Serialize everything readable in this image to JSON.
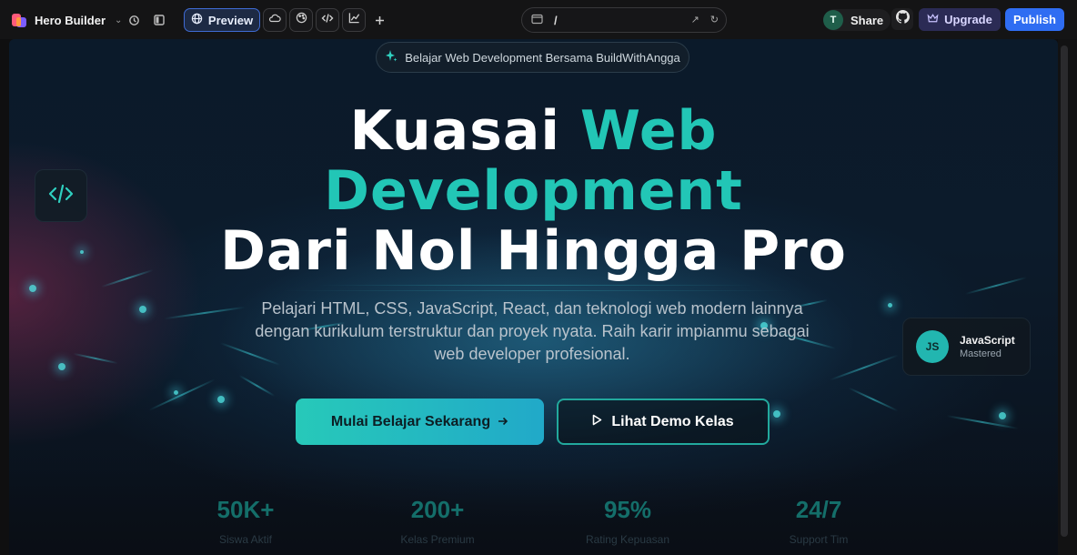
{
  "topbar": {
    "app_title": "Hero Builder",
    "preview_label": "Preview",
    "url_path": "/",
    "share_avatar": "T",
    "share_label": "Share",
    "upgrade_label": "Upgrade",
    "publish_label": "Publish",
    "icons": [
      "history-icon",
      "sidebar-toggle-icon",
      "globe-icon",
      "cloud-icon",
      "palette-icon",
      "code-icon",
      "chart-icon",
      "plus-icon",
      "external-link-icon",
      "refresh-icon",
      "github-icon",
      "crown-icon"
    ]
  },
  "hero": {
    "badge": "Belajar Web Development Bersama BuildWithAngga",
    "headline": {
      "line1_white": "Kuasai ",
      "line1_teal": "Web",
      "line2_teal": "Development",
      "line3_white": "Dari Nol Hingga Pro"
    },
    "subtitle": "Pelajari HTML, CSS, JavaScript, React, dan teknologi web modern lainnya dengan kurikulum terstruktur dan proyek nyata. Raih karir impianmu sebagai web developer profesional.",
    "cta_primary": "Mulai Belajar Sekarang",
    "cta_secondary": "Lihat Demo Kelas",
    "js_card": {
      "initials": "JS",
      "title": "JavaScript",
      "subtitle": "Mastered"
    },
    "stats": [
      {
        "value": "50K+",
        "label": "Siswa Aktif"
      },
      {
        "value": "200+",
        "label": "Kelas Premium"
      },
      {
        "value": "95%",
        "label": "Rating Kepuasan"
      },
      {
        "value": "24/7",
        "label": "Support Tim"
      }
    ]
  },
  "colors": {
    "accent_teal": "#22c6b6",
    "publish_blue": "#2f6df2",
    "upgrade_bg": "#2b2b55",
    "preview_border": "#3f6bd3"
  }
}
